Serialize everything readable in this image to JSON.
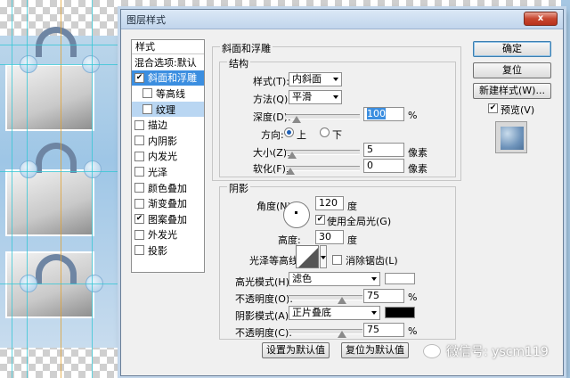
{
  "dialog": {
    "title": "图层样式",
    "close_label": "x"
  },
  "styles_list": {
    "header": "样式",
    "blend_options": "混合选项:默认",
    "items": [
      {
        "label": "斜面和浮雕",
        "checked": true,
        "selected": true,
        "indent": false
      },
      {
        "label": "等高线",
        "checked": false,
        "selected": false,
        "indent": true
      },
      {
        "label": "纹理",
        "checked": false,
        "selected": false,
        "indent": true,
        "sub_selected": true
      },
      {
        "label": "描边",
        "checked": false
      },
      {
        "label": "内阴影",
        "checked": false
      },
      {
        "label": "内发光",
        "checked": false
      },
      {
        "label": "光泽",
        "checked": false
      },
      {
        "label": "颜色叠加",
        "checked": false
      },
      {
        "label": "渐变叠加",
        "checked": false
      },
      {
        "label": "图案叠加",
        "checked": true
      },
      {
        "label": "外发光",
        "checked": false
      },
      {
        "label": "投影",
        "checked": false
      }
    ]
  },
  "bevel": {
    "section_title": "斜面和浮雕",
    "structure_title": "结构",
    "style_label": "样式(T):",
    "style_value": "内斜面",
    "technique_label": "方法(Q):",
    "technique_value": "平滑",
    "depth_label": "深度(D):",
    "depth_value": "100",
    "depth_unit": "%",
    "depth_fraction": 0.1,
    "direction_label": "方向:",
    "direction_up": "上",
    "direction_down": "下",
    "direction_selected": "上",
    "size_label": "大小(Z):",
    "size_value": "5",
    "size_unit": "像素",
    "size_fraction": 0.03,
    "soften_label": "软化(F):",
    "soften_value": "0",
    "soften_unit": "像素",
    "soften_fraction": 0.0
  },
  "shading": {
    "title": "阴影",
    "angle_label": "角度(N):",
    "angle_value": "120",
    "angle_unit": "度",
    "global_light_label": "使用全局光(G)",
    "global_light_checked": true,
    "altitude_label": "高度:",
    "altitude_value": "30",
    "altitude_unit": "度",
    "gloss_contour_label": "光泽等高线:",
    "anti_aliased_label": "消除锯齿(L)",
    "anti_aliased_checked": false,
    "highlight_mode_label": "高光模式(H):",
    "highlight_mode_value": "滤色",
    "highlight_color": "#ffffff",
    "highlight_opacity_label": "不透明度(O):",
    "highlight_opacity_value": "75",
    "highlight_opacity_unit": "%",
    "highlight_opacity_fraction": 0.75,
    "shadow_mode_label": "阴影模式(A):",
    "shadow_mode_value": "正片叠底",
    "shadow_color": "#000000",
    "shadow_opacity_label": "不透明度(C):",
    "shadow_opacity_value": "75",
    "shadow_opacity_unit": "%",
    "shadow_opacity_fraction": 0.75
  },
  "footer": {
    "make_default": "设置为默认值",
    "reset_default": "复位为默认值"
  },
  "right_panel": {
    "ok": "确定",
    "reset": "复位",
    "new_style": "新建样式(W)...",
    "preview_label": "预览(V)",
    "preview_checked": true
  },
  "watermark": {
    "text": "微信号: yscm119"
  },
  "colors": {
    "accent": "#3b8ee0",
    "guide": "#37c7d6"
  }
}
